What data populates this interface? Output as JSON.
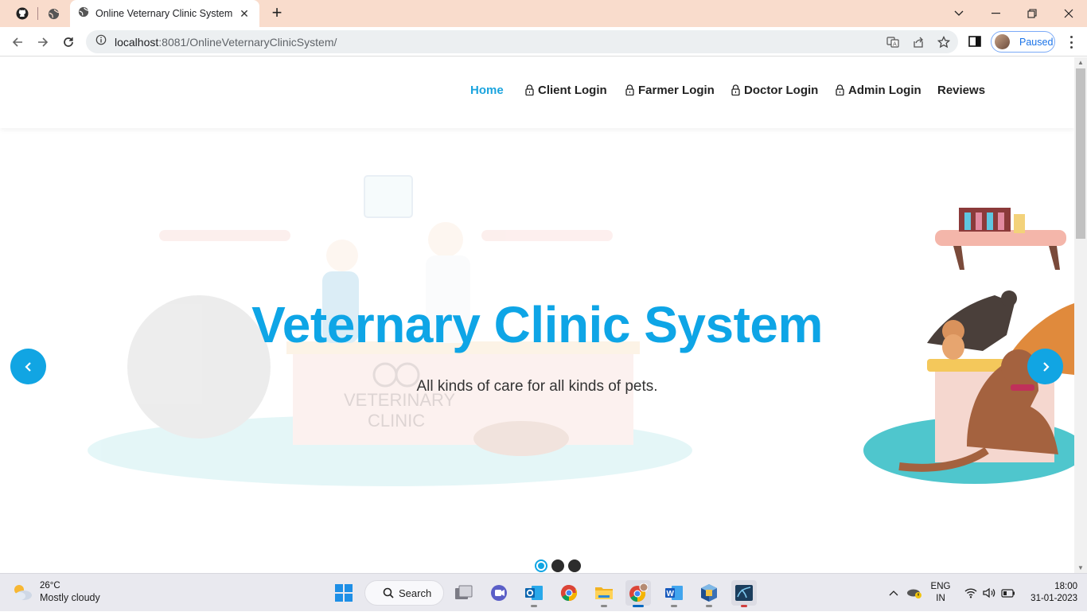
{
  "browser": {
    "tab_title": "Online Veternary Clinic System",
    "url_host": "localhost",
    "url_rest": ":8081/OnlineVeternaryClinicSystem/",
    "profile_status": "Paused",
    "colors": {
      "tabbar": "#f9dccc",
      "accent": "#1a73e8"
    }
  },
  "site": {
    "nav": [
      {
        "label": "Home",
        "active": true,
        "icon": ""
      },
      {
        "label": "Client Login",
        "active": false,
        "icon": "lock-icon"
      },
      {
        "label": "Farmer Login",
        "active": false,
        "icon": "lock-icon"
      },
      {
        "label": "Doctor Login",
        "active": false,
        "icon": "lock-icon"
      },
      {
        "label": "Admin Login",
        "active": false,
        "icon": "lock-icon"
      },
      {
        "label": "Reviews",
        "active": false,
        "icon": ""
      }
    ],
    "hero": {
      "title": "Veternary Clinic System",
      "subtitle": "All kinds of care for all kinds of pets.",
      "watermark": "VETERINARY\nCLINIC",
      "slides": 3,
      "active_slide": 1
    },
    "colors": {
      "primary": "#11a5e3",
      "title": "#0ea5e6"
    }
  },
  "taskbar": {
    "weather_temp": "26°C",
    "weather_desc": "Mostly cloudy",
    "search_label": "Search",
    "lang_top": "ENG",
    "lang_bottom": "IN",
    "time": "18:00",
    "date": "31-01-2023",
    "apps": [
      "windows-start-icon",
      "search",
      "task-view-icon",
      "teams-icon",
      "outlook-icon",
      "chrome-icon",
      "file-explorer-icon",
      "chrome-profile-icon",
      "word-icon",
      "virtualbox-icon",
      "mysql-workbench-icon"
    ]
  }
}
